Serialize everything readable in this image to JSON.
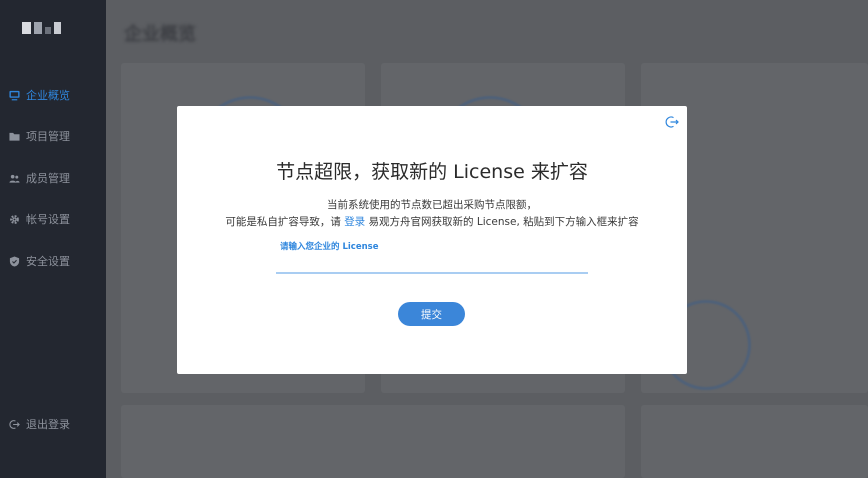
{
  "sidebar": {
    "items": [
      {
        "label": "企业概览",
        "icon": "monitor-icon",
        "active": true
      },
      {
        "label": "项目管理",
        "icon": "folder-icon",
        "active": false
      },
      {
        "label": "成员管理",
        "icon": "users-icon",
        "active": false
      },
      {
        "label": "帐号设置",
        "icon": "gear-icon",
        "active": false
      },
      {
        "label": "安全设置",
        "icon": "shield-icon",
        "active": false
      }
    ],
    "logout_label": "退出登录"
  },
  "main": {
    "page_title": "企业概览"
  },
  "modal": {
    "title": "节点超限，获取新的 License 来扩容",
    "desc_line1": "当前系统使用的节点数已超出采购节点限额，",
    "desc_line2_prefix": "可能是私自扩容导致，请",
    "desc_line2_link": "登录",
    "desc_line2_suffix": "易观方舟官网获取新的 License, 粘贴到下方输入框来扩容",
    "field_label": "请输入您企业的 License",
    "field_value": "",
    "submit_label": "提交"
  },
  "colors": {
    "accent": "#2f86dd",
    "sidebar_bg": "#232730",
    "overlay": "#5c5e62"
  }
}
